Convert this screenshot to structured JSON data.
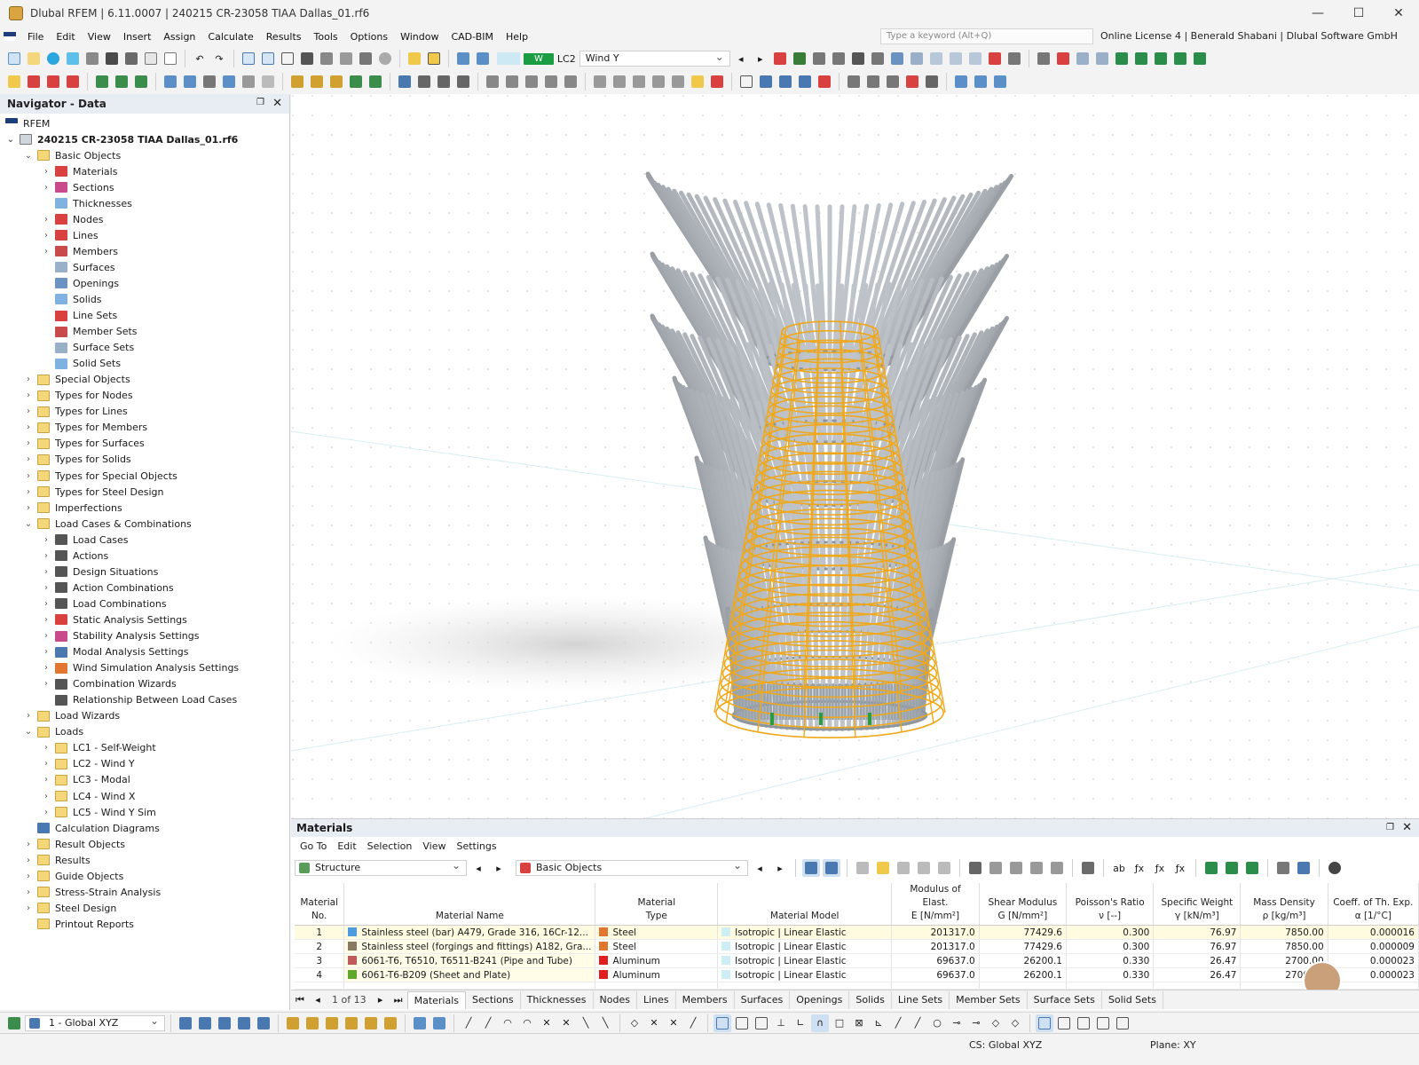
{
  "window": {
    "title": "Dlubal RFEM | 6.11.0007 | 240215 CR-23058 TIAA Dallas_01.rf6"
  },
  "menu": [
    "File",
    "Edit",
    "View",
    "Insert",
    "Assign",
    "Calculate",
    "Results",
    "Tools",
    "Options",
    "Window",
    "CAD-BIM",
    "Help"
  ],
  "search": {
    "placeholder": "Type a keyword (Alt+Q)"
  },
  "license": "Online License 4 | Benerald Shabani | Dlubal Software GmbH",
  "loadcase": {
    "badge": "W",
    "id": "LC2",
    "name": "Wind Y"
  },
  "navigator": {
    "title": "Navigator - Data",
    "root": "RFEM",
    "file": "240215 CR-23058 TIAA Dallas_01.rf6",
    "items": [
      {
        "label": "Basic Objects",
        "level": 1,
        "arrow": "v"
      },
      {
        "label": "Materials",
        "level": 2,
        "arrow": ">"
      },
      {
        "label": "Sections",
        "level": 2,
        "arrow": ">"
      },
      {
        "label": "Thicknesses",
        "level": 2,
        "arrow": ""
      },
      {
        "label": "Nodes",
        "level": 2,
        "arrow": ">"
      },
      {
        "label": "Lines",
        "level": 2,
        "arrow": ">"
      },
      {
        "label": "Members",
        "level": 2,
        "arrow": ">"
      },
      {
        "label": "Surfaces",
        "level": 2,
        "arrow": ""
      },
      {
        "label": "Openings",
        "level": 2,
        "arrow": ""
      },
      {
        "label": "Solids",
        "level": 2,
        "arrow": ""
      },
      {
        "label": "Line Sets",
        "level": 2,
        "arrow": ""
      },
      {
        "label": "Member Sets",
        "level": 2,
        "arrow": ""
      },
      {
        "label": "Surface Sets",
        "level": 2,
        "arrow": ""
      },
      {
        "label": "Solid Sets",
        "level": 2,
        "arrow": ""
      },
      {
        "label": "Special Objects",
        "level": 1,
        "arrow": ">"
      },
      {
        "label": "Types for Nodes",
        "level": 1,
        "arrow": ">"
      },
      {
        "label": "Types for Lines",
        "level": 1,
        "arrow": ">"
      },
      {
        "label": "Types for Members",
        "level": 1,
        "arrow": ">"
      },
      {
        "label": "Types for Surfaces",
        "level": 1,
        "arrow": ">"
      },
      {
        "label": "Types for Solids",
        "level": 1,
        "arrow": ">"
      },
      {
        "label": "Types for Special Objects",
        "level": 1,
        "arrow": ">"
      },
      {
        "label": "Types for Steel Design",
        "level": 1,
        "arrow": ">"
      },
      {
        "label": "Imperfections",
        "level": 1,
        "arrow": ">"
      },
      {
        "label": "Load Cases & Combinations",
        "level": 1,
        "arrow": "v"
      },
      {
        "label": "Load Cases",
        "level": 2,
        "arrow": ">"
      },
      {
        "label": "Actions",
        "level": 2,
        "arrow": ">"
      },
      {
        "label": "Design Situations",
        "level": 2,
        "arrow": ">"
      },
      {
        "label": "Action Combinations",
        "level": 2,
        "arrow": ">"
      },
      {
        "label": "Load Combinations",
        "level": 2,
        "arrow": ">"
      },
      {
        "label": "Static Analysis Settings",
        "level": 2,
        "arrow": ">"
      },
      {
        "label": "Stability Analysis Settings",
        "level": 2,
        "arrow": ">"
      },
      {
        "label": "Modal Analysis Settings",
        "level": 2,
        "arrow": ">"
      },
      {
        "label": "Wind Simulation Analysis Settings",
        "level": 2,
        "arrow": ">"
      },
      {
        "label": "Combination Wizards",
        "level": 2,
        "arrow": ">"
      },
      {
        "label": "Relationship Between Load Cases",
        "level": 2,
        "arrow": ""
      },
      {
        "label": "Load Wizards",
        "level": 1,
        "arrow": ">"
      },
      {
        "label": "Loads",
        "level": 1,
        "arrow": "v"
      },
      {
        "label": "LC1 - Self-Weight",
        "level": 2,
        "arrow": ">"
      },
      {
        "label": "LC2 - Wind Y",
        "level": 2,
        "arrow": ">"
      },
      {
        "label": "LC3 - Modal",
        "level": 2,
        "arrow": ">"
      },
      {
        "label": "LC4 - Wind X",
        "level": 2,
        "arrow": ">"
      },
      {
        "label": "LC5 - Wind Y Sim",
        "level": 2,
        "arrow": ">"
      },
      {
        "label": "Calculation Diagrams",
        "level": 1,
        "arrow": ""
      },
      {
        "label": "Result Objects",
        "level": 1,
        "arrow": ">"
      },
      {
        "label": "Results",
        "level": 1,
        "arrow": ">"
      },
      {
        "label": "Guide Objects",
        "level": 1,
        "arrow": ">"
      },
      {
        "label": "Stress-Strain Analysis",
        "level": 1,
        "arrow": ">"
      },
      {
        "label": "Steel Design",
        "level": 1,
        "arrow": ">"
      },
      {
        "label": "Printout Reports",
        "level": 1,
        "arrow": ""
      }
    ]
  },
  "materials_panel": {
    "title": "Materials",
    "menu": [
      "Go To",
      "Edit",
      "Selection",
      "View",
      "Settings"
    ],
    "combo1": "Structure",
    "combo2": "Basic Objects",
    "headers": [
      [
        "Material",
        "No."
      ],
      [
        "",
        "Material Name"
      ],
      [
        "Material",
        "Type"
      ],
      [
        "",
        "Material Model"
      ],
      [
        "Modulus of Elast.",
        "E [N/mm²]"
      ],
      [
        "Shear Modulus",
        "G [N/mm²]"
      ],
      [
        "Poisson's Ratio",
        "ν [--]"
      ],
      [
        "Specific Weight",
        "γ [kN/m³]"
      ],
      [
        "Mass Density",
        "ρ [kg/m³]"
      ],
      [
        "Coeff. of Th. Exp.",
        "α [1/°C]"
      ]
    ],
    "rows": [
      {
        "no": "1",
        "name": "Stainless steel (bar) A479, Grade 316, 16Cr-12...",
        "name_color": "#4f9be0",
        "type": "Steel",
        "type_color": "#e0762f",
        "model": "Isotropic | Linear Elastic",
        "E": "201317.0",
        "G": "77429.6",
        "nu": "0.300",
        "gamma": "76.97",
        "rho": "7850.00",
        "alpha": "0.000016"
      },
      {
        "no": "2",
        "name": "Stainless steel (forgings and fittings) A182, Gra...",
        "name_color": "#8a7a62",
        "type": "Steel",
        "type_color": "#e0762f",
        "model": "Isotropic | Linear Elastic",
        "E": "201317.0",
        "G": "77429.6",
        "nu": "0.300",
        "gamma": "76.97",
        "rho": "7850.00",
        "alpha": "0.000009"
      },
      {
        "no": "3",
        "name": "6061-T6, T6510, T6511-B241 (Pipe and Tube)",
        "name_color": "#c05a5a",
        "type": "Aluminum",
        "type_color": "#e01d1d",
        "model": "Isotropic | Linear Elastic",
        "E": "69637.0",
        "G": "26200.1",
        "nu": "0.330",
        "gamma": "26.47",
        "rho": "2700.00",
        "alpha": "0.000023"
      },
      {
        "no": "4",
        "name": "6061-T6-B209 (Sheet and Plate)",
        "name_color": "#5fa82a",
        "type": "Aluminum",
        "type_color": "#e01d1d",
        "model": "Isotropic | Linear Elastic",
        "E": "69637.0",
        "G": "26200.1",
        "nu": "0.330",
        "gamma": "26.47",
        "rho": "2700.00",
        "alpha": "0.000023"
      }
    ],
    "pager": "1 of 13",
    "tabs": [
      "Materials",
      "Sections",
      "Thicknesses",
      "Nodes",
      "Lines",
      "Members",
      "Surfaces",
      "Openings",
      "Solids",
      "Line Sets",
      "Member Sets",
      "Surface Sets",
      "Solid Sets"
    ]
  },
  "bottom_combo": "1 - Global XYZ",
  "status": {
    "cs": "CS: Global XYZ",
    "plane": "Plane: XY"
  },
  "colors": {
    "accent": "#1f3d7a",
    "wire": "#f0a81a",
    "struct": "#9aa3aa"
  }
}
